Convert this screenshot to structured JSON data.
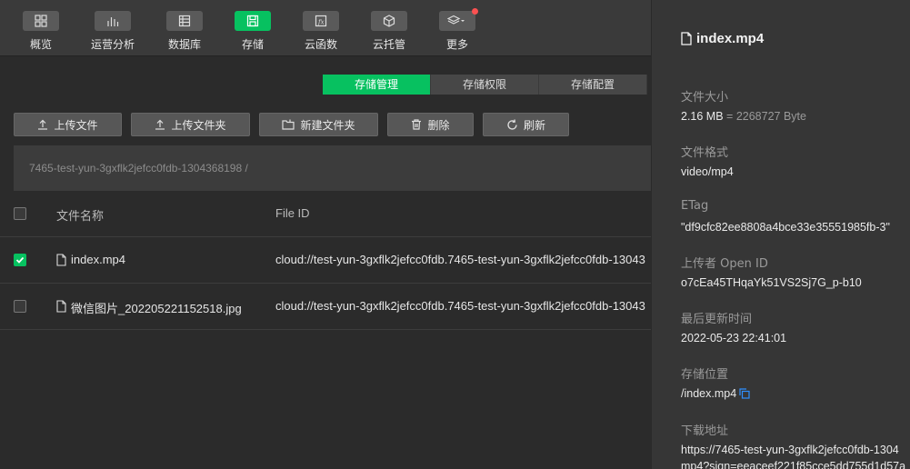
{
  "toolbar": {
    "items": [
      {
        "label": "概览",
        "icon": "dashboard-icon"
      },
      {
        "label": "运营分析",
        "icon": "bar-chart-icon"
      },
      {
        "label": "数据库",
        "icon": "database-icon"
      },
      {
        "label": "存储",
        "icon": "save-icon"
      },
      {
        "label": "云函数",
        "icon": "function-icon"
      },
      {
        "label": "云托管",
        "icon": "cube-icon"
      },
      {
        "label": "更多",
        "icon": "layers-icon"
      }
    ]
  },
  "tabs": [
    "存储管理",
    "存储权限",
    "存储配置"
  ],
  "actions": {
    "upload_file": "上传文件",
    "upload_folder": "上传文件夹",
    "new_folder": "新建文件夹",
    "delete": "删除",
    "refresh": "刷新"
  },
  "path": "7465-test-yun-3gxflk2jefcc0fdb-1304368198 /",
  "table": {
    "headers": {
      "name": "文件名称",
      "fileid": "File ID"
    },
    "rows": [
      {
        "name": "index.mp4",
        "fileid": "cloud://test-yun-3gxflk2jefcc0fdb.7465-test-yun-3gxflk2jefcc0fdb-13043",
        "checked": true
      },
      {
        "name": "微信图片_202205221152518.jpg",
        "fileid": "cloud://test-yun-3gxflk2jefcc0fdb.7465-test-yun-3gxflk2jefcc0fdb-13043",
        "checked": false
      }
    ]
  },
  "detail": {
    "title": "index.mp4",
    "size_label": "文件大小",
    "size_value": "2.16 MB",
    "size_bytes": "= 2268727 Byte",
    "format_label": "文件格式",
    "format_value": "video/mp4",
    "etag_label": "ETag",
    "etag_value": "\"df9cfc82ee8808a4bce33e35551985fb-3\"",
    "uploader_label": "上传者 Open ID",
    "uploader_value": "o7cEa45THqaYk51VS2Sj7G_p-b10",
    "updated_label": "最后更新时间",
    "updated_value": "2022-05-23 22:41:01",
    "location_label": "存储位置",
    "location_value": "/index.mp4",
    "download_label": "下载地址",
    "download_line1": "https://7465-test-yun-3gxflk2jefcc0fdb-1304",
    "download_line2": "mp4?sign=eeaceef221f85cce5dd755d1d57a"
  },
  "colors": {
    "accent": "#07c160",
    "badge": "#fa5151"
  }
}
